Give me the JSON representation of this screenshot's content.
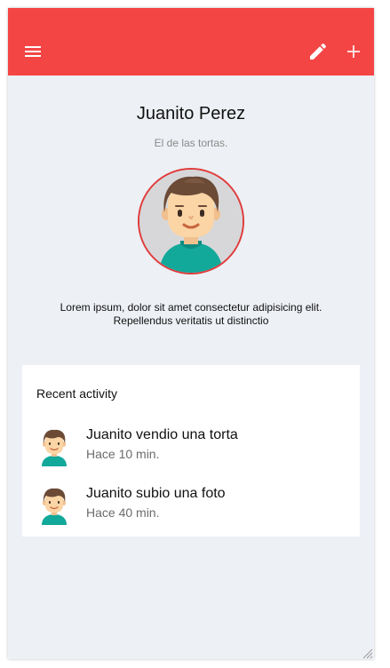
{
  "toolbar": {
    "color": "#f44545",
    "menu_icon": "menu-icon",
    "edit_icon": "pencil-icon",
    "add_icon": "plus-icon"
  },
  "profile": {
    "name": "Juanito Perez",
    "tagline": "El de las tortas.",
    "bio_line1": "Lorem ipsum, dolor sit amet consectetur adipisicing elit.",
    "bio_line2": "Repellendus veritatis ut distinctio",
    "avatar_border_color": "#e03b3b"
  },
  "activity": {
    "title": "Recent activity",
    "items": [
      {
        "title": "Juanito vendio una torta",
        "subtitle": "Hace 10 min."
      },
      {
        "title": "Juanito subio una foto",
        "subtitle": "Hace 40 min."
      }
    ]
  }
}
